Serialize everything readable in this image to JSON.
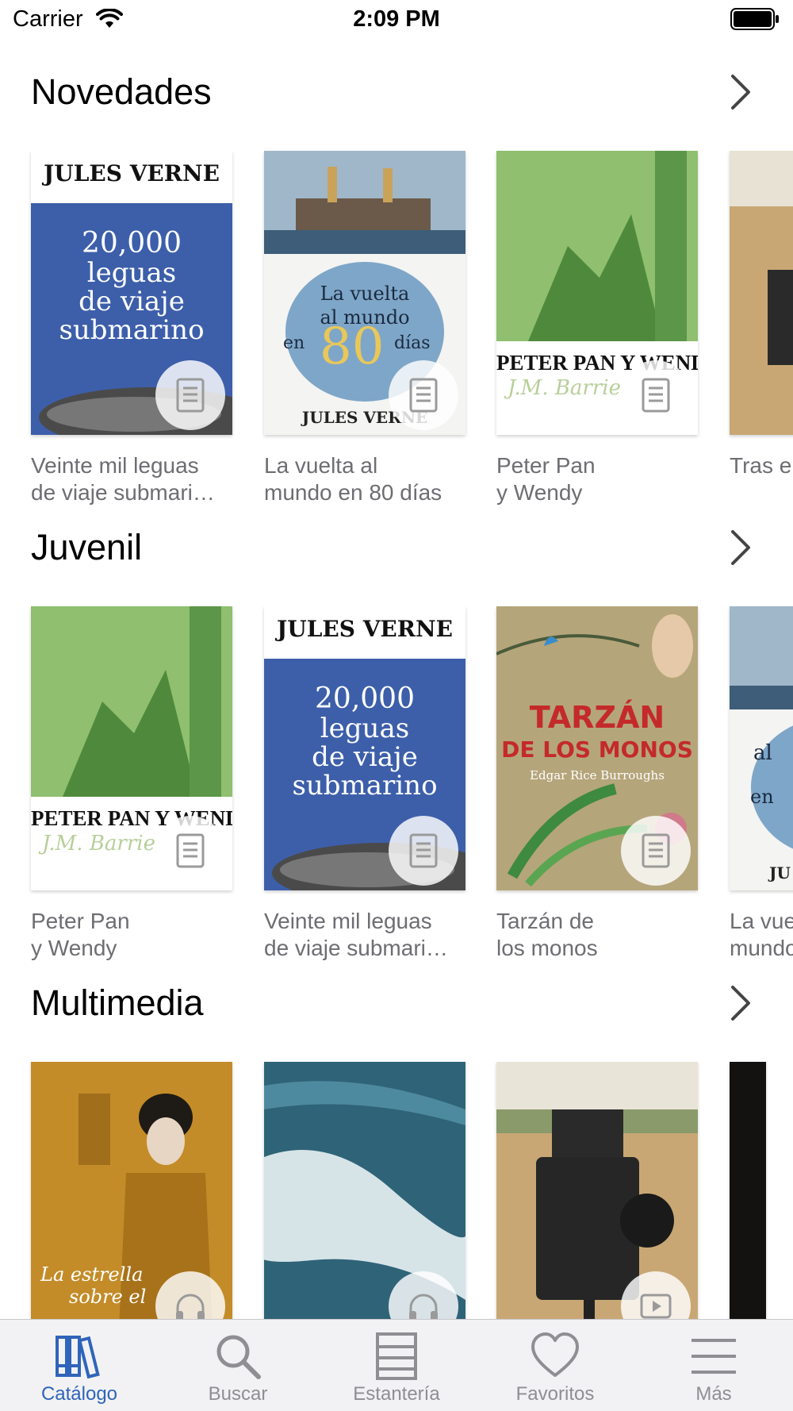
{
  "status_bar": {
    "carrier": "Carrier",
    "time": "2:09 PM"
  },
  "sections": [
    {
      "title": "Novedades",
      "books": [
        {
          "caption": "Veinte mil leguas\nde viaje submari…",
          "cover_text": [
            "JULES VERNE",
            "20,000",
            "leguas",
            "de viaje",
            "submarino"
          ],
          "badge_icon": "document-icon"
        },
        {
          "caption": "La vuelta al\nmundo en 80 días",
          "cover_text": [
            "La vuelta",
            "al mundo",
            "en",
            "80",
            "días",
            "JULES VERNE"
          ],
          "badge_icon": "document-icon"
        },
        {
          "caption": "Peter Pan\ny Wendy",
          "cover_text": [
            "PETER PAN Y WENDY",
            "J.M. Barrie"
          ],
          "badge_icon": "document-icon"
        },
        {
          "caption": "Tras e",
          "cover_text": [],
          "badge_icon": ""
        }
      ]
    },
    {
      "title": "Juvenil",
      "books": [
        {
          "caption": "Peter Pan\ny Wendy",
          "cover_text": [
            "PETER PAN Y WENDY",
            "J.M. Barrie"
          ],
          "badge_icon": "document-icon"
        },
        {
          "caption": "Veinte mil leguas\nde viaje submari…",
          "cover_text": [
            "JULES VERNE",
            "20,000",
            "leguas",
            "de viaje",
            "submarino"
          ],
          "badge_icon": "document-icon"
        },
        {
          "caption": "Tarzán de\nlos monos",
          "cover_text": [
            "TARZÁN",
            "DE LOS MONOS",
            "Edgar Rice Burroughs"
          ],
          "badge_icon": "document-icon"
        },
        {
          "caption": "La vue\nmundo",
          "cover_text": [
            "al",
            "en",
            "JU"
          ],
          "badge_icon": ""
        }
      ]
    },
    {
      "title": "Multimedia",
      "books": [
        {
          "caption": "",
          "cover_text": [
            "La estrella",
            "sobre el"
          ],
          "badge_icon": "headphones-icon"
        },
        {
          "caption": "",
          "cover_text": [],
          "badge_icon": "headphones-icon"
        },
        {
          "caption": "",
          "cover_text": [],
          "badge_icon": "play-video-icon"
        },
        {
          "caption": "",
          "cover_text": [],
          "badge_icon": ""
        }
      ]
    }
  ],
  "tab_bar": {
    "tabs": [
      {
        "label": "Catálogo",
        "icon": "books-icon",
        "active": true
      },
      {
        "label": "Buscar",
        "icon": "search-icon",
        "active": false
      },
      {
        "label": "Estantería",
        "icon": "shelf-icon",
        "active": false
      },
      {
        "label": "Favoritos",
        "icon": "heart-icon",
        "active": false
      },
      {
        "label": "Más",
        "icon": "menu-icon",
        "active": false
      }
    ]
  },
  "colors": {
    "accent": "#2f64ba",
    "inactive": "#8e8e93",
    "caption": "#6d6d72",
    "tab_background": "#f2f2f4"
  }
}
